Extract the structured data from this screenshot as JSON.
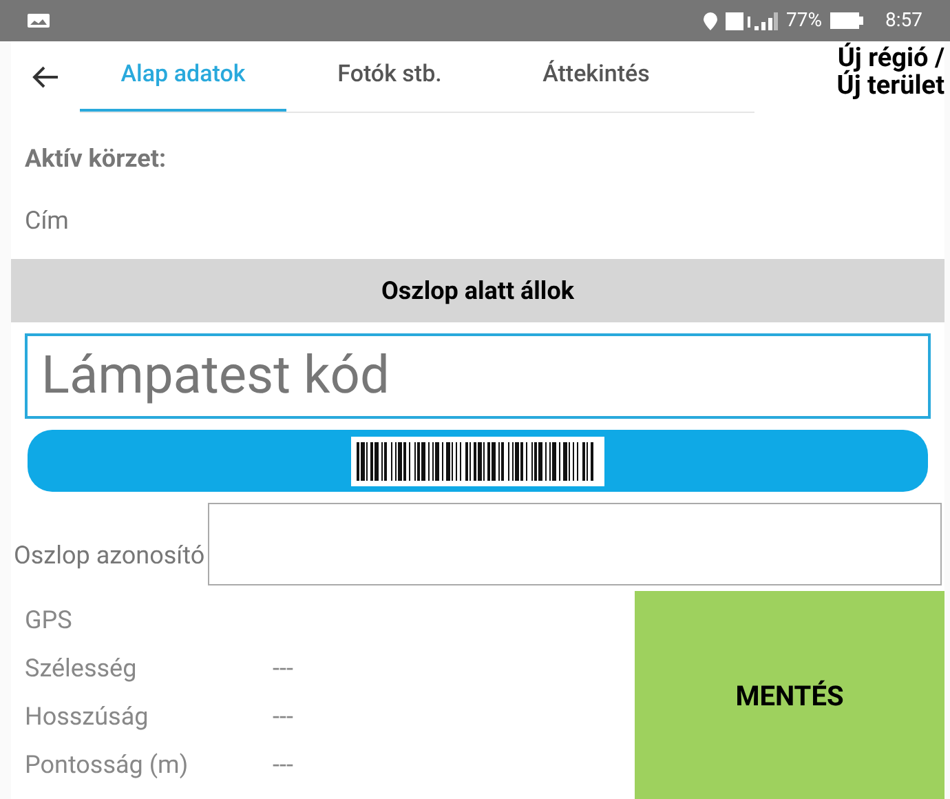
{
  "status_bar": {
    "battery": "77%",
    "time": "8:57"
  },
  "tabs": [
    {
      "label": "Alap adatok",
      "selected": true
    },
    {
      "label": "Fotók stb.",
      "selected": false
    },
    {
      "label": "Áttekintés",
      "selected": false
    }
  ],
  "title_lines": [
    "Új régió /",
    "Új terület"
  ],
  "active_district_label": "Aktív körzet:",
  "address_label": "Cím",
  "under_pole_button": "Oszlop alatt állok",
  "lamp_code_field": {
    "placeholder": "Lámpatest kód"
  },
  "pole_id": {
    "label": "Oszlop azonosító"
  },
  "gps": {
    "heading": "GPS",
    "rows": [
      {
        "label": "Szélesség",
        "value": "---"
      },
      {
        "label": "Hosszúság",
        "value": "---"
      },
      {
        "label": "Pontosság (m)",
        "value": "---"
      }
    ]
  },
  "save_button": "MENTÉS"
}
